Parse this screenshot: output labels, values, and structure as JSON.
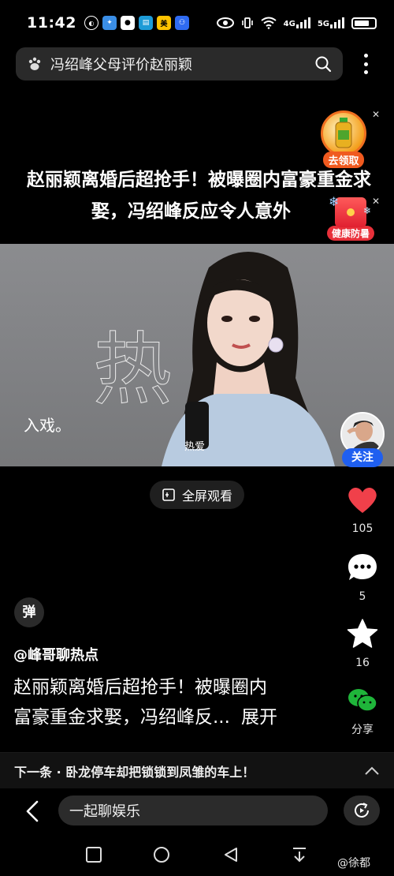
{
  "status_bar": {
    "time": "11:42",
    "network_labels": [
      "4G",
      "5G"
    ]
  },
  "search": {
    "query": "冯绍峰父母评价赵丽颖"
  },
  "headline": {
    "line1": "赵丽颖离婚后超抢手！被曝圈内富豪重金求",
    "line2": "娶，冯绍峰反应令人意外"
  },
  "promos": [
    {
      "label": "去领取",
      "color": "#f05a1f"
    },
    {
      "label": "健康防暑",
      "color": "#e8303a"
    }
  ],
  "video": {
    "wall_text": "热",
    "watermark": "入戏。",
    "mic_label": "热爱"
  },
  "fullscreen": {
    "label": "全屏观看"
  },
  "actions": {
    "follow_label": "关注",
    "like_count": "105",
    "comment_count": "5",
    "favorite_count": "16",
    "share_label": "分享"
  },
  "danmaku": {
    "label": "弹"
  },
  "post": {
    "author": "@峰哥聊热点",
    "desc_line1": "赵丽颖离婚后超抢手！被曝圈内",
    "desc_line2": "富豪重金求娶，冯绍峰反...",
    "expand_label": "展开"
  },
  "next": {
    "text": "下一条 · 卧龙停车却把锁锁到凤雏的车上！"
  },
  "comment": {
    "placeholder": "一起聊娱乐"
  },
  "credit": {
    "text": "@徐都"
  },
  "colors": {
    "like_red": "#f0404a",
    "follow_blue": "#1f5ff0",
    "wechat_green": "#1fb53a"
  }
}
